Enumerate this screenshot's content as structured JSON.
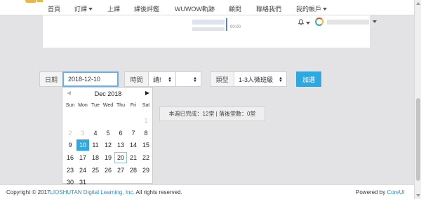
{
  "nav": {
    "items": [
      {
        "label": "首頁",
        "has_caret": false
      },
      {
        "label": "訂課",
        "has_caret": true
      },
      {
        "label": "上課",
        "has_caret": false
      },
      {
        "label": "課後評鑑",
        "has_caret": false
      },
      {
        "label": "WUWOW軌跡",
        "has_caret": false
      },
      {
        "label": "顧問",
        "has_caret": false
      },
      {
        "label": "聯絡我們",
        "has_caret": false
      },
      {
        "label": "我的帳戶",
        "has_caret": true
      }
    ]
  },
  "card": {
    "time_text": "00:00"
  },
  "filters": {
    "date_label": "日期",
    "date_value": "2018-12-10",
    "time_label": "時間",
    "time_value": "請!",
    "type_label": "類型",
    "type_value": "1-3人微班級",
    "add_button": "加選"
  },
  "datepicker": {
    "month_title": "Dec 2018",
    "prev_glyph": "◀",
    "next_glyph": "▶",
    "weekdays": [
      "Sun",
      "Mon",
      "Tue",
      "Wed",
      "Thu",
      "Fri",
      "Sat"
    ],
    "weeks": [
      [
        "",
        "",
        "",
        "",
        "",
        "",
        "1"
      ],
      [
        "2",
        "3",
        "4",
        "5",
        "6",
        "7",
        "8"
      ],
      [
        "9",
        "10",
        "11",
        "12",
        "13",
        "14",
        "15"
      ],
      [
        "16",
        "17",
        "18",
        "19",
        "20",
        "21",
        "22"
      ],
      [
        "23",
        "24",
        "25",
        "26",
        "27",
        "28",
        "29"
      ],
      [
        "30",
        "31",
        "",
        "",
        "",
        "",
        ""
      ]
    ],
    "muted": [
      "1",
      "2",
      "3"
    ],
    "selected": "10",
    "today": "20"
  },
  "summary": {
    "text": "本週已完成：12堂 | 落後堂數：0堂"
  },
  "footer": {
    "copyright_prefix": "Copyright © 2017",
    "company": "LIOSHUTAN Digital Learning, Inc.",
    "rights": " All rights reserved.",
    "powered_prefix": "Powered by ",
    "powered_link": "CoreUI"
  },
  "colors": {
    "accent": "#2ea8e0",
    "focus": "#66afe9"
  }
}
